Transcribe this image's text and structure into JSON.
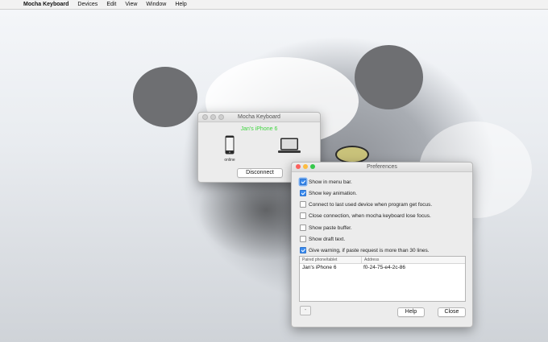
{
  "menubar": {
    "apple_glyph": "",
    "app_name": "Mocha Keyboard",
    "items": [
      "Devices",
      "Edit",
      "View",
      "Window",
      "Help"
    ]
  },
  "mocha_window": {
    "title": "Mocha Keyboard",
    "device_name": "Jan's iPhone 6",
    "device_name_color": "#3fd43f",
    "status": "online",
    "disconnect_label": "Disconnect",
    "icons": [
      "phone-icon",
      "laptop-icon"
    ]
  },
  "preferences": {
    "title": "Preferences",
    "options": [
      {
        "label": "Show in menu bar.",
        "checked": true
      },
      {
        "label": "Show key animation.",
        "checked": true
      },
      {
        "label": "Connect to last used device when program get focus.",
        "checked": false
      },
      {
        "label": "Close connection, when mocha keyboard lose focus.",
        "checked": false
      },
      {
        "label": "Show paste buffer.",
        "checked": false
      },
      {
        "label": "Show draft text.",
        "checked": false
      },
      {
        "label": "Give warning, if paste request is more than 30 lines.",
        "checked": true
      }
    ],
    "table": {
      "headers": [
        "Paired phone/tablet",
        "Address"
      ],
      "rows": [
        {
          "name": "Jan's iPhone 6",
          "address": "f0-24-75-e4-2c-86"
        }
      ]
    },
    "minus_label": "-",
    "help_label": "Help",
    "close_label": "Close"
  },
  "colors": {
    "accent": "#3b8cf0",
    "close_light": "#fc605c",
    "minimize_light": "#fdbc40",
    "zoom_light": "#34c84a"
  }
}
